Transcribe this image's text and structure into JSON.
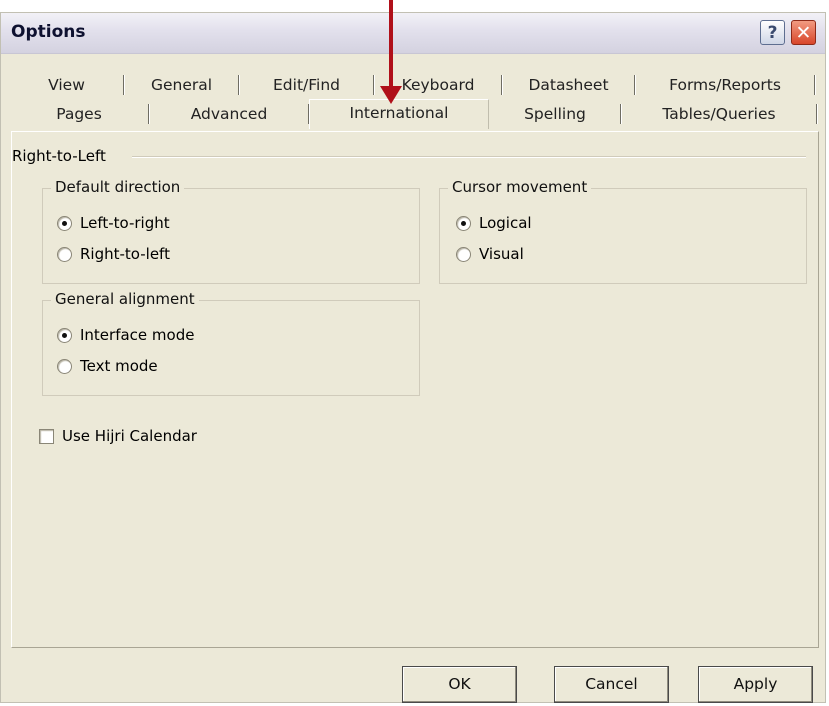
{
  "window": {
    "title": "Options"
  },
  "titlebar": {
    "help_glyph": "?",
    "close_glyph": "✕"
  },
  "tabs_back_row": [
    "View",
    "General",
    "Edit/Find",
    "Keyboard",
    "Datasheet",
    "Forms/Reports"
  ],
  "tabs_front_row": [
    "Pages",
    "Advanced",
    "International",
    "Spelling",
    "Tables/Queries"
  ],
  "active_tab": "International",
  "section": {
    "label": "Right-to-Left"
  },
  "default_direction": {
    "legend": "Default direction",
    "options": [
      {
        "label": "Left-to-right",
        "checked": true
      },
      {
        "label": "Right-to-left",
        "checked": false
      }
    ]
  },
  "cursor_movement": {
    "legend": "Cursor movement",
    "options": [
      {
        "label": "Logical",
        "checked": true
      },
      {
        "label": "Visual",
        "checked": false
      }
    ]
  },
  "general_alignment": {
    "legend": "General alignment",
    "options": [
      {
        "label": "Interface mode",
        "checked": true
      },
      {
        "label": "Text mode",
        "checked": false
      }
    ]
  },
  "hijri": {
    "label": "Use Hijri Calendar",
    "checked": false
  },
  "buttons": {
    "ok": "OK",
    "cancel": "Cancel",
    "apply": "Apply"
  },
  "colors": {
    "annotation_arrow": "#b0101a",
    "dialog_bg": "#ece9d8"
  }
}
